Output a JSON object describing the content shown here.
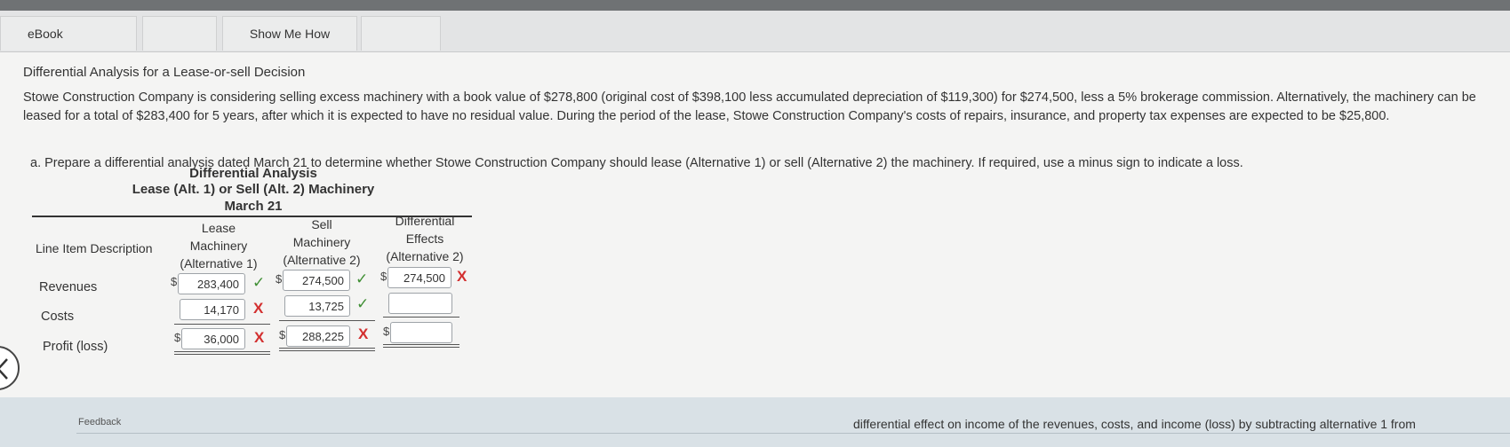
{
  "tabs": {
    "ebook": "eBook",
    "show_me_how": "Show Me How"
  },
  "problem": {
    "title": "Differential Analysis for a Lease-or-sell Decision",
    "paragraph": "Stowe Construction Company is considering selling excess machinery with a book value of $278,800 (original cost of $398,100 less accumulated depreciation of $119,300) for $274,500, less a 5% brokerage commission. Alternatively, the machinery can be leased for a total of $283,400 for 5 years, after which it is expected to have no residual value. During the period of the lease, Stowe Construction Company's costs of repairs, insurance, and property tax expenses are expected to be $25,800.",
    "instruction": "a.  Prepare a differential analysis dated March 21 to determine whether Stowe Construction Company should lease (Alternative 1) or sell (Alternative 2) the machinery. If required, use a minus sign to indicate a loss."
  },
  "analysis": {
    "heading1": "Differential Analysis",
    "heading2": "Lease (Alt. 1) or Sell (Alt. 2) Machinery",
    "heading3": "March 21",
    "col_line_item": "Line Item Description",
    "col_lease": [
      "Lease",
      "Machinery",
      "(Alternative 1)"
    ],
    "col_sell": [
      "Sell",
      "Machinery",
      "(Alternative 2)"
    ],
    "col_diff": [
      "Differential",
      "Effects",
      "(Alternative 2)"
    ],
    "dollar_sign": "$",
    "rows": {
      "revenues": {
        "label": "Revenues",
        "lease": "283,400",
        "sell": "274,500",
        "diff": "274,500"
      },
      "costs": {
        "label": "Costs",
        "lease": "14,170",
        "sell": "13,725",
        "diff": ""
      },
      "profit": {
        "label": "Profit (loss)",
        "lease": "36,000",
        "sell": "288,225",
        "diff": ""
      }
    },
    "marks": {
      "correct": "✓",
      "incorrect": "X"
    }
  },
  "feedback": {
    "label": "Feedback",
    "text": "differential effect on income of the revenues, costs, and income (loss) by subtracting alternative 1 from"
  },
  "colors": {
    "correct": "#3f8f34",
    "incorrect": "#d32f2f"
  }
}
